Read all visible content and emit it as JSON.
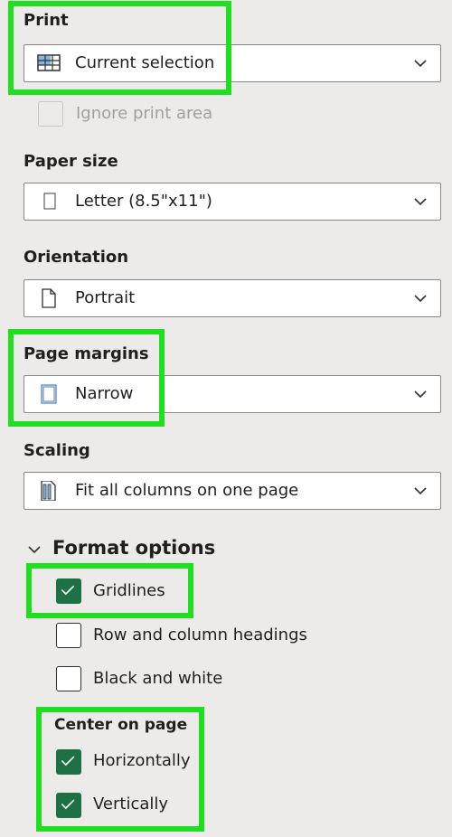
{
  "print": {
    "label": "Print",
    "value": "Current selection",
    "icon": "table-selection-icon"
  },
  "ignore_print_area": {
    "label": "Ignore print area",
    "checked": false,
    "disabled": true
  },
  "paper_size": {
    "label": "Paper size",
    "value": "Letter (8.5\"x11\")",
    "icon": "page-icon"
  },
  "orientation": {
    "label": "Orientation",
    "value": "Portrait",
    "icon": "portrait-page-icon"
  },
  "page_margins": {
    "label": "Page margins",
    "value": "Narrow",
    "icon": "narrow-margins-icon"
  },
  "scaling": {
    "label": "Scaling",
    "value": "Fit all columns on one page",
    "icon": "fit-columns-icon"
  },
  "format_options": {
    "title": "Format options",
    "expanded": true,
    "items": [
      {
        "label": "Gridlines",
        "checked": true
      },
      {
        "label": "Row and column headings",
        "checked": false
      },
      {
        "label": "Black and white",
        "checked": false
      }
    ]
  },
  "center_on_page": {
    "title": "Center on page",
    "items": [
      {
        "label": "Horizontally",
        "checked": true
      },
      {
        "label": "Vertically",
        "checked": true
      }
    ]
  },
  "colors": {
    "highlight": "#1ee01e",
    "checkbox_checked": "#1e7145",
    "background": "#edebe9"
  }
}
